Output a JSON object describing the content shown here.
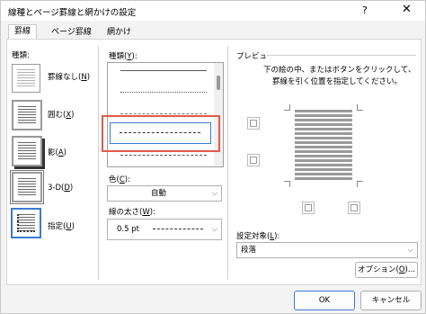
{
  "window": {
    "title": "線種とページ罫線と網かけの設定",
    "help": "?",
    "close": "✕"
  },
  "tabs": [
    {
      "label": "罫線"
    },
    {
      "label": "ページ罫線"
    },
    {
      "label": "網かけ"
    }
  ],
  "setting": {
    "label": "種類:",
    "options": [
      {
        "label": "罫線なし(",
        "key": "N",
        "end": ")"
      },
      {
        "label": "囲む(",
        "key": "X",
        "end": ")"
      },
      {
        "label": "影(",
        "key": "A",
        "end": ")"
      },
      {
        "label": "3-D(",
        "key": "D",
        "end": ")"
      },
      {
        "label": "指定(",
        "key": "U",
        "end": ")"
      }
    ]
  },
  "style": {
    "label": "種類(",
    "key": "Y",
    "end": "):"
  },
  "color": {
    "label": "色(",
    "key": "C",
    "end": "):",
    "value": "自動"
  },
  "width": {
    "label": "線の太さ(",
    "key": "W",
    "end": "):",
    "value": "0.5 pt"
  },
  "preview": {
    "label": "プレビュー",
    "instructions_line1": "下の絵の中、またはボタンをクリックして、",
    "instructions_line2": "罫線を引く位置を指定してください。"
  },
  "apply_to": {
    "label": "設定対象(",
    "key": "L",
    "end": "):",
    "value": "段落"
  },
  "options_button": {
    "label": "オプション(",
    "key": "O",
    "end": ")..."
  },
  "footer": {
    "ok": "OK",
    "cancel": "キャンセル"
  }
}
